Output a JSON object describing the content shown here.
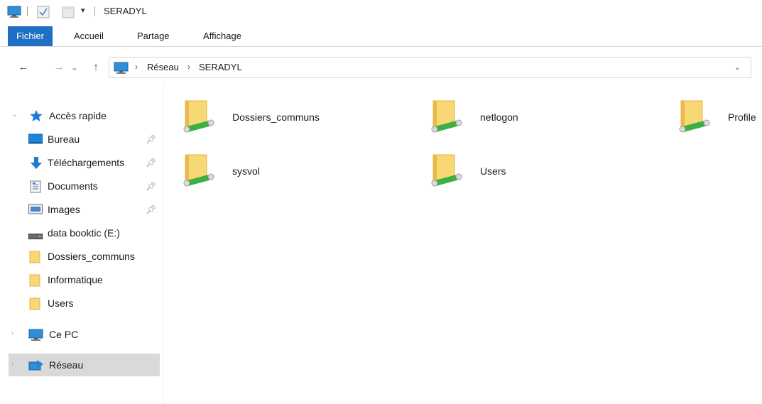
{
  "window": {
    "title": "SERADYL",
    "quick_access_toolbar": [
      "computer-icon",
      "properties-check-icon",
      "new-folder-icon",
      "customize-dropdown-icon"
    ]
  },
  "ribbon": {
    "tabs": [
      "Fichier",
      "Accueil",
      "Partage",
      "Affichage"
    ],
    "active_tab_color": "#1f6fc5"
  },
  "navigation": {
    "back_icon": "←",
    "forward_icon": "→",
    "recent_icon": "⌄",
    "up_icon": "↑"
  },
  "address_bar": {
    "breadcrumbs": [
      "Réseau",
      "SERADYL"
    ],
    "separator": "›"
  },
  "nav_pane": {
    "quick_access": {
      "label": "Accès rapide",
      "items": [
        {
          "label": "Bureau",
          "icon": "desktop-icon",
          "pinned": true
        },
        {
          "label": "Téléchargements",
          "icon": "download-icon",
          "pinned": true
        },
        {
          "label": "Documents",
          "icon": "documents-icon",
          "pinned": true
        },
        {
          "label": "Images",
          "icon": "images-icon",
          "pinned": true
        },
        {
          "label": "data booktic (E:)",
          "icon": "drive-icon",
          "pinned": false
        },
        {
          "label": "Dossiers_communs",
          "icon": "folder-icon",
          "pinned": false
        },
        {
          "label": "Informatique",
          "icon": "folder-icon",
          "pinned": false
        },
        {
          "label": "Users",
          "icon": "folder-icon",
          "pinned": false
        }
      ]
    },
    "this_pc": {
      "label": "Ce PC"
    },
    "network": {
      "label": "Réseau",
      "selected": true
    },
    "selected_color": "#d9d9d9"
  },
  "shares": [
    {
      "label": "Dossiers_communs"
    },
    {
      "label": "netlogon"
    },
    {
      "label": "Profile"
    },
    {
      "label": "sysvol"
    },
    {
      "label": "Users"
    }
  ],
  "colors": {
    "folder": "#f8d775",
    "folder_dark": "#e9b949",
    "network_pipe": "#3cb043",
    "accent": "#1f6fc5"
  }
}
